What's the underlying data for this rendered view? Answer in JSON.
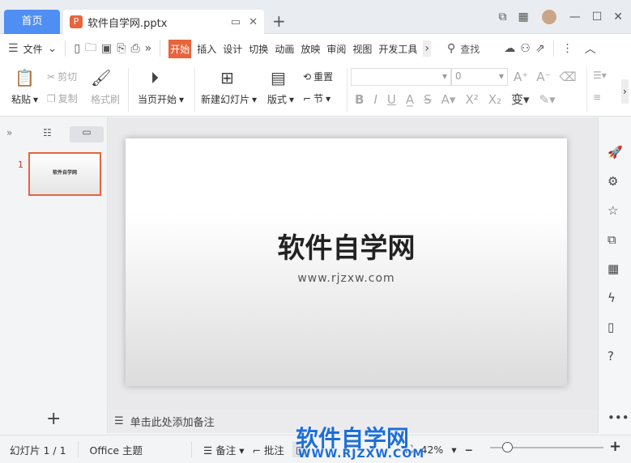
{
  "tabs": {
    "home": "首页",
    "document": "软件自学网.pptx"
  },
  "menu": {
    "file": "文件",
    "items": [
      "开始",
      "插入",
      "设计",
      "切换",
      "动画",
      "放映",
      "审阅",
      "视图",
      "开发工具"
    ],
    "search": "查找"
  },
  "ribbon": {
    "paste": "粘贴",
    "cut": "剪切",
    "copy": "复制",
    "format_painter": "格式刷",
    "play_from_current": "当页开始",
    "new_slide": "新建幻灯片",
    "layout": "版式",
    "reset": "重置",
    "section": "节",
    "font_size": "0"
  },
  "thumbnails": [
    {
      "number": "1",
      "title": "软件自学网"
    }
  ],
  "slide": {
    "title": "软件自学网",
    "subtitle": "www.rjzxw.com"
  },
  "notes": {
    "placeholder": "单击此处添加备注"
  },
  "status": {
    "slide_count": "幻灯片 1 / 1",
    "theme": "Office 主题",
    "notes": "备注",
    "comments": "批注",
    "zoom": "42%"
  },
  "watermark": {
    "text": "软件自学网",
    "url": "WWW.RJZXW.COM"
  }
}
